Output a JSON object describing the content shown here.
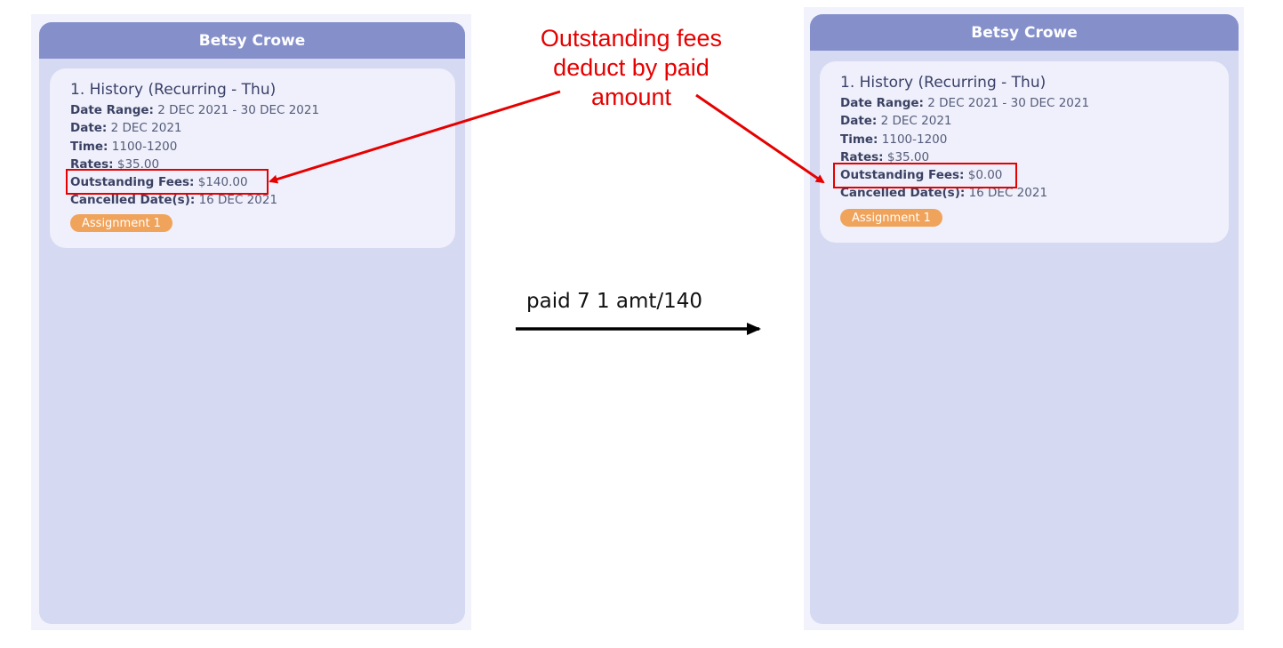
{
  "before": {
    "student_name": "Betsy Crowe",
    "lesson": {
      "title": "1.  History (Recurring - Thu)",
      "date_range_label": "Date Range:",
      "date_range_value": "2 DEC 2021 - 30 DEC 2021",
      "date_label": "Date:",
      "date_value": "2 DEC 2021",
      "time_label": "Time:",
      "time_value": "1100-1200",
      "rates_label": "Rates:",
      "rates_value": "$35.00",
      "outstanding_label": "Outstanding Fees:",
      "outstanding_value": "$140.00",
      "cancelled_label": "Cancelled Date(s):",
      "cancelled_value": "16 DEC 2021",
      "homework_tag": "Assignment 1"
    }
  },
  "after": {
    "student_name": "Betsy Crowe",
    "lesson": {
      "title": "1.  History (Recurring - Thu)",
      "date_range_label": "Date Range:",
      "date_range_value": "2 DEC 2021 - 30 DEC 2021",
      "date_label": "Date:",
      "date_value": "2 DEC 2021",
      "time_label": "Time:",
      "time_value": "1100-1200",
      "rates_label": "Rates:",
      "rates_value": "$35.00",
      "outstanding_label": "Outstanding Fees:",
      "outstanding_value": "$0.00",
      "cancelled_label": "Cancelled Date(s):",
      "cancelled_value": "16 DEC 2021",
      "homework_tag": "Assignment 1"
    }
  },
  "annotation": {
    "line1": "Outstanding fees",
    "line2": "deduct by paid",
    "line3": "amount"
  },
  "command": "paid 7 1 amt/140",
  "colors": {
    "header": "#8590cb",
    "panel": "#d5d9f2",
    "card": "#eff0fb",
    "tag": "#f0a35b",
    "highlight": "#e60000"
  }
}
